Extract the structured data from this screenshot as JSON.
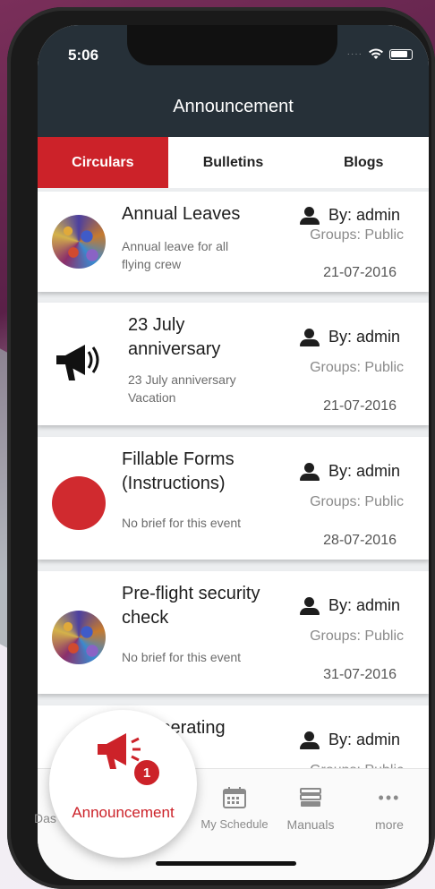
{
  "status_bar": {
    "time": "5:06"
  },
  "header": {
    "title": "Announcement"
  },
  "tabs": [
    {
      "label": "Circulars",
      "active": true
    },
    {
      "label": "Bulletins",
      "active": false
    },
    {
      "label": "Blogs",
      "active": false
    }
  ],
  "cards": [
    {
      "title": "Annual Leaves",
      "brief": "Annual leave for all flying crew",
      "author": "By: admin",
      "groups": "Groups: Public",
      "date": "21-07-2016",
      "avatar": "pattern-image"
    },
    {
      "title": "23 July anniversary",
      "brief": "23 July anniversary Vacation",
      "author": "By: admin",
      "groups": "Groups: Public",
      "date": "21-07-2016",
      "avatar": "megaphone-icon"
    },
    {
      "title": "Fillable Forms (Instructions)",
      "brief": "No brief for this event",
      "author": "By: admin",
      "groups": "Groups: Public",
      "date": "28-07-2016",
      "avatar": "red-circle"
    },
    {
      "title": "Pre-flight security check",
      "brief": "No brief for this event",
      "author": "By: admin",
      "groups": "Groups: Public",
      "date": "31-07-2016",
      "avatar": "pattern-image"
    },
    {
      "title": "...f Operating ...first ...",
      "author": "By: admin",
      "groups": "Groups: Public",
      "avatar": "red-circle"
    }
  ],
  "bottom_nav": {
    "dashboard_label": "Das",
    "announcement_label": "Announcement",
    "announcement_badge": "1",
    "schedule_label": "My Schedule",
    "manuals_label": "Manuals",
    "more_label": "more"
  },
  "colors": {
    "accent": "#cc2229",
    "header_bg": "#263038"
  }
}
